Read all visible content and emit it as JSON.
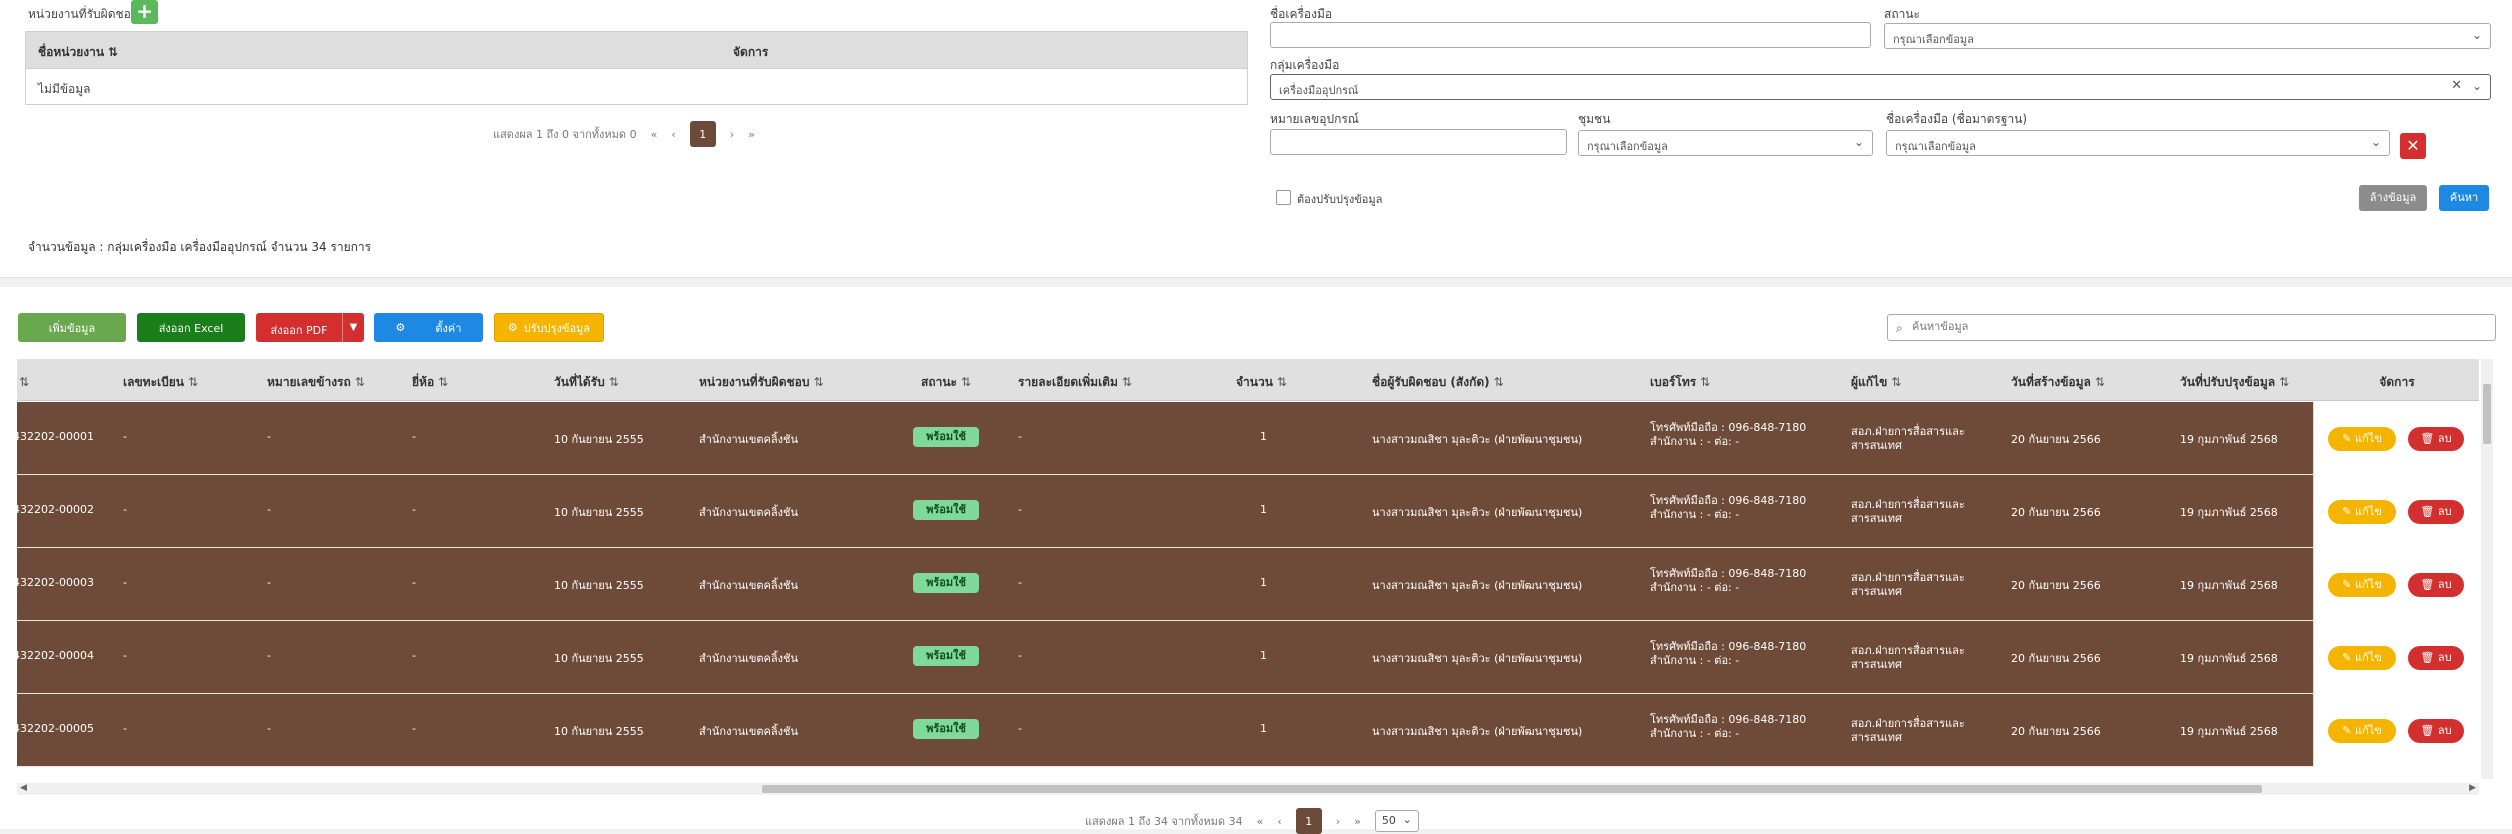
{
  "agency_panel": {
    "label": "หน่วยงานที่รับผิดชอบ",
    "add_icon": "+",
    "columns": [
      "ชื่อหน่วยงาน",
      "จัดการ"
    ],
    "sort_icon": "⇅",
    "empty_text": "ไม่มีข้อมูล",
    "pager_text": "แสดงผล 1 ถึง 0 จากทั้งหมด 0",
    "pager_first": "«",
    "pager_prev": "‹",
    "pager_page": "1",
    "pager_next": "›",
    "pager_last": "»"
  },
  "count_line": "จำนวนข้อมูล : กลุ่มเครื่องมือ เครื่องมืออุปกรณ์   จำนวน 34 รายการ",
  "filters": {
    "tool_name_label": "ชื่อเครื่องมือ",
    "tool_name_value": "",
    "status_label": "สถานะ",
    "status_value": "กรุณาเลือกข้อมูล",
    "group_label": "กลุ่มเครื่องมือ",
    "group_value": "เครื่องมืออุปกรณ์",
    "serial_label": "หมายเลขอุปกรณ์",
    "serial_value": "",
    "community_label": "ชุมชน",
    "community_value": "กรุณาเลือกข้อมูล",
    "std_name_label": "ชื่อเครื่องมือ (ชื่อมาตรฐาน)",
    "std_name_value": "กรุณาเลือกข้อมูล",
    "remove_icon": "✕",
    "clear_icon": "✕",
    "chevron": "⌄",
    "checkbox_label": "ต้องปรับปรุงข้อมูล",
    "clear_button": "ล้างข้อมูล",
    "search_button": "ค้นหา"
  },
  "toolbar": {
    "add": "เพิ่มข้อมูล",
    "excel": "ส่งออก Excel",
    "pdf": "ส่งออก PDF",
    "pdf_caret": "▼",
    "settings_icon": "⚙",
    "settings": "ตั้งค่า",
    "update_icon": "⚙",
    "update": "ปรับปรุงข้อมูล",
    "search_placeholder": "ค้นหาข้อมูล",
    "search_icon": "⌕"
  },
  "table": {
    "sort_icon": "⇅",
    "headers": {
      "code": "ี",
      "reg": "เลขทะเบียน",
      "plate": "หมายเลขข้างรถ",
      "brand": "ยี่ห้อ",
      "recv": "วันที่ได้รับ",
      "agency": "หน่วยงานที่รับผิดชอบ",
      "status": "สถานะ",
      "detail": "รายละเอียดเพิ่มเติม",
      "qty": "จำนวน",
      "owner": "ชื่อผู้รับผิดชอบ (สังกัด)",
      "phone": "เบอร์โทร",
      "creator": "ผู้แก้ไข",
      "created": "วันที่สร้างข้อมูล",
      "updated": "วันที่ปรับปรุงข้อมูล",
      "actions": "จัดการ"
    },
    "edit_label": "✎ แก้ไข",
    "delete_label": "🗑 ลบ",
    "rows": [
      {
        "code": "432202-00001",
        "reg": "-",
        "plate": "-",
        "brand": "-",
        "recv": "10 กันยายน 2555",
        "agency": "สำนักงานเขตคลิ้งชัน",
        "status": "พร้อมใช้",
        "detail": "-",
        "qty": "1",
        "owner": "นางสาวมณสิชา มุละติวะ (ฝ่ายพัฒนาชุมชน)",
        "phone1": "โทรศัพท์มือถือ : 096-848-7180",
        "phone2": "สำนักงาน : - ต่อ: -",
        "creator1": "สอภ.ฝ่ายการสื่อสารและ",
        "creator2": "สารสนเทศ",
        "created": "20 กันยายน 2566",
        "updated": "19 กุมภาพันธ์ 2568"
      },
      {
        "code": "432202-00002",
        "reg": "-",
        "plate": "-",
        "brand": "-",
        "recv": "10 กันยายน 2555",
        "agency": "สำนักงานเขตคลิ้งชัน",
        "status": "พร้อมใช้",
        "detail": "-",
        "qty": "1",
        "owner": "นางสาวมณสิชา มุละติวะ (ฝ่ายพัฒนาชุมชน)",
        "phone1": "โทรศัพท์มือถือ : 096-848-7180",
        "phone2": "สำนักงาน : - ต่อ: -",
        "creator1": "สอภ.ฝ่ายการสื่อสารและ",
        "creator2": "สารสนเทศ",
        "created": "20 กันยายน 2566",
        "updated": "19 กุมภาพันธ์ 2568"
      },
      {
        "code": "432202-00003",
        "reg": "-",
        "plate": "-",
        "brand": "-",
        "recv": "10 กันยายน 2555",
        "agency": "สำนักงานเขตคลิ้งชัน",
        "status": "พร้อมใช้",
        "detail": "-",
        "qty": "1",
        "owner": "นางสาวมณสิชา มุละติวะ (ฝ่ายพัฒนาชุมชน)",
        "phone1": "โทรศัพท์มือถือ : 096-848-7180",
        "phone2": "สำนักงาน : - ต่อ: -",
        "creator1": "สอภ.ฝ่ายการสื่อสารและ",
        "creator2": "สารสนเทศ",
        "created": "20 กันยายน 2566",
        "updated": "19 กุมภาพันธ์ 2568"
      },
      {
        "code": "432202-00004",
        "reg": "-",
        "plate": "-",
        "brand": "-",
        "recv": "10 กันยายน 2555",
        "agency": "สำนักงานเขตคลิ้งชัน",
        "status": "พร้อมใช้",
        "detail": "-",
        "qty": "1",
        "owner": "นางสาวมณสิชา มุละติวะ (ฝ่ายพัฒนาชุมชน)",
        "phone1": "โทรศัพท์มือถือ : 096-848-7180",
        "phone2": "สำนักงาน : - ต่อ: -",
        "creator1": "สอภ.ฝ่ายการสื่อสารและ",
        "creator2": "สารสนเทศ",
        "created": "20 กันยายน 2566",
        "updated": "19 กุมภาพันธ์ 2568"
      },
      {
        "code": "432202-00005",
        "reg": "-",
        "plate": "-",
        "brand": "-",
        "recv": "10 กันยายน 2555",
        "agency": "สำนักงานเขตคลิ้งชัน",
        "status": "พร้อมใช้",
        "detail": "-",
        "qty": "1",
        "owner": "นางสาวมณสิชา มุละติวะ (ฝ่ายพัฒนาชุมชน)",
        "phone1": "โทรศัพท์มือถือ : 096-848-7180",
        "phone2": "สำนักงาน : - ต่อ: -",
        "creator1": "สอภ.ฝ่ายการสื่อสารและ",
        "creator2": "สารสนเทศ",
        "created": "20 กันยายน 2566",
        "updated": "19 กุมภาพันธ์ 2568"
      }
    ]
  },
  "main_pager": {
    "text": "แสดงผล 1 ถึง 34 จากทั้งหมด 34",
    "first": "«",
    "prev": "‹",
    "page": "1",
    "next": "›",
    "last": "»",
    "page_size": "50",
    "page_size_chevron": "⌄"
  },
  "colors": {
    "row_bg": "#6e4a38",
    "status_badge": "#7ed99a",
    "primary": "#1e88e5",
    "danger": "#d32f2f",
    "warning": "#f4b400",
    "success": "#6aa84f"
  }
}
